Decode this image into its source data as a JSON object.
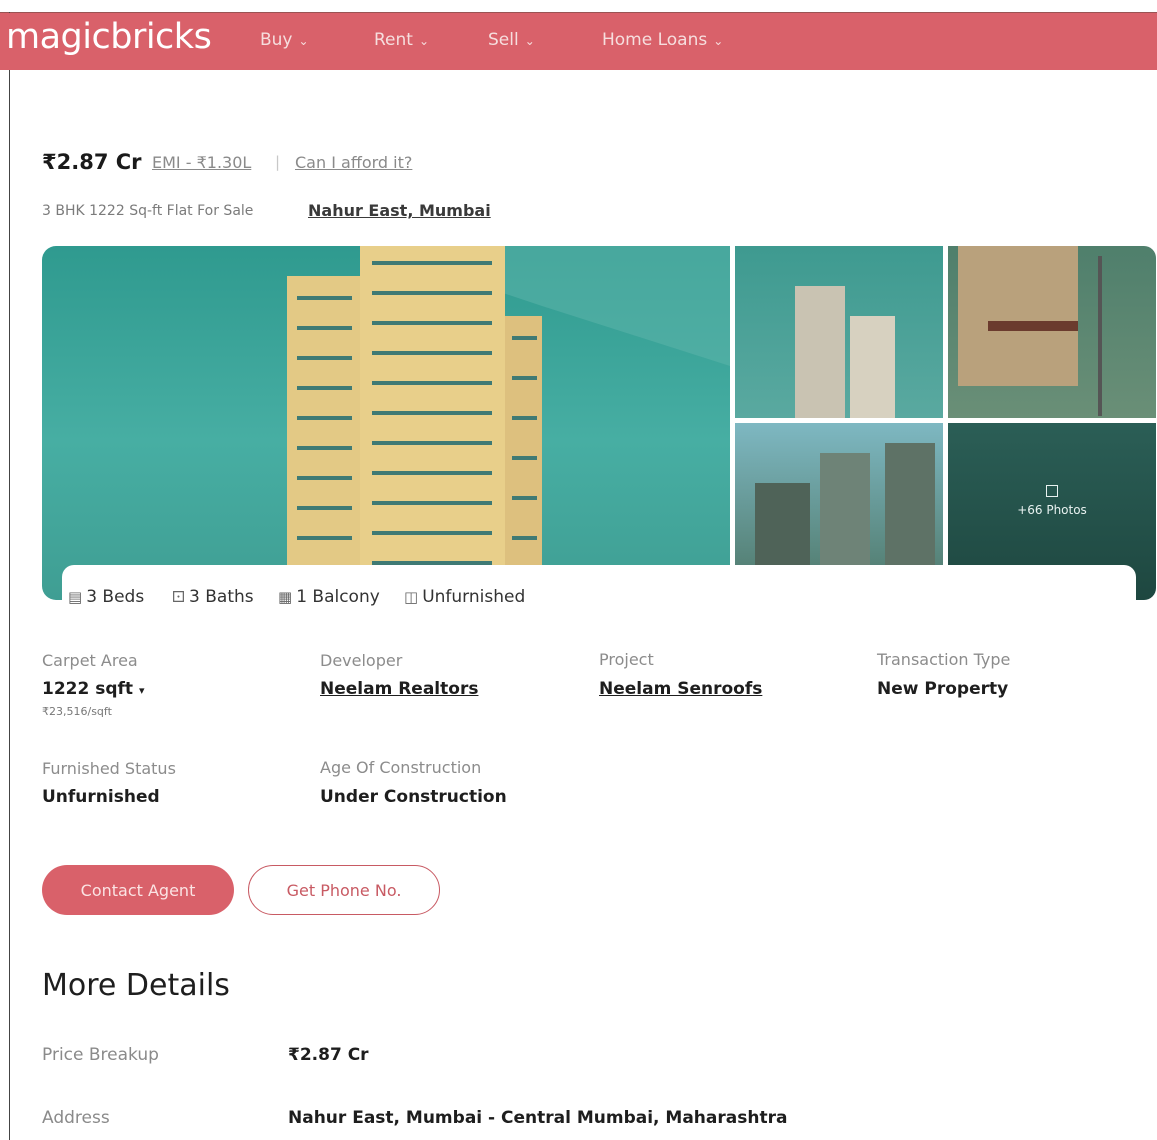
{
  "header": {
    "logo": "magicbricks",
    "nav": [
      {
        "label": "Buy"
      },
      {
        "label": "Rent"
      },
      {
        "label": "Sell"
      },
      {
        "label": "Home Loans"
      }
    ]
  },
  "listing": {
    "price": "₹2.87 Cr",
    "emi": "EMI - ₹1.30L",
    "separator": "|",
    "afford": "Can I afford it?",
    "subtitle": "3 BHK 1222 Sq-ft Flat For Sale",
    "locality": "Nahur East, Mumbai"
  },
  "gallery": {
    "more_photos": "+66 Photos"
  },
  "amenities": {
    "beds": "3 Beds",
    "baths": "3 Baths",
    "balcony": "1 Balcony",
    "furnishing": "Unfurnished"
  },
  "facts": {
    "carpet_area_label": "Carpet Area",
    "carpet_area_value": "1222 sqft",
    "carpet_area_rate": "₹23,516/sqft",
    "developer_label": "Developer",
    "developer_value": "Neelam Realtors",
    "project_label": "Project",
    "project_value": "Neelam Senroofs",
    "transaction_label": "Transaction Type",
    "transaction_value": "New Property",
    "furnished_label": "Furnished Status",
    "furnished_value": "Unfurnished",
    "age_label": "Age Of Construction",
    "age_value": "Under Construction"
  },
  "actions": {
    "contact": "Contact Agent",
    "phone": "Get Phone No."
  },
  "more_details": {
    "title": "More Details",
    "rows": [
      {
        "label": "Price Breakup",
        "value": "₹2.87 Cr"
      },
      {
        "label": "Address",
        "value": "Nahur East, Mumbai - Central Mumbai, Maharashtra"
      }
    ]
  },
  "colors": {
    "brand": "#d9616a"
  }
}
